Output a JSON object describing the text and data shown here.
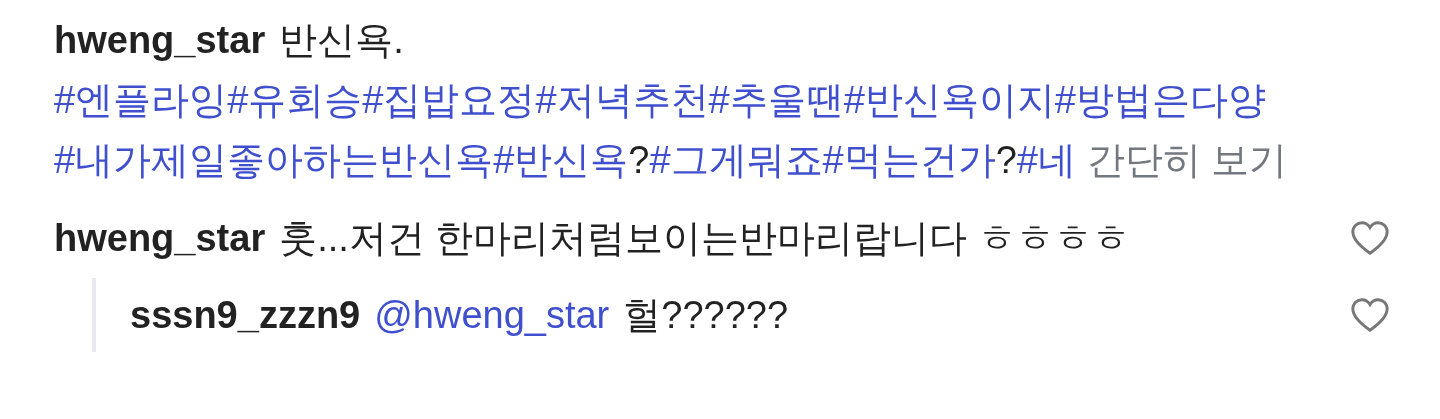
{
  "caption": {
    "username": "hweng_star",
    "text": "반신욕.",
    "parts": [
      {
        "kind": "hashtag",
        "text": "#엔플라잉"
      },
      {
        "kind": "hashtag",
        "text": "#유회승"
      },
      {
        "kind": "hashtag",
        "text": "#집밥요정"
      },
      {
        "kind": "hashtag",
        "text": "#저녁추천"
      },
      {
        "kind": "hashtag",
        "text": "#추울땐"
      },
      {
        "kind": "hashtag",
        "text": "#반신욕이지"
      },
      {
        "kind": "hashtag",
        "text": "#방법은다양"
      },
      {
        "kind": "hashtag",
        "text": "#내가제일좋아하는반신욕"
      },
      {
        "kind": "hashtag",
        "text": "#반신욕"
      },
      {
        "kind": "text",
        "text": "?"
      },
      {
        "kind": "hashtag",
        "text": "#그게뭐죠"
      },
      {
        "kind": "hashtag",
        "text": "#먹는건가"
      },
      {
        "kind": "text",
        "text": "?"
      },
      {
        "kind": "hashtag",
        "text": "#네"
      }
    ],
    "collapse_link": "간단히 보기"
  },
  "comments": [
    {
      "username": "hweng_star",
      "text": "훗...저건 한마리처럼보이는반마리랍니다 ㅎㅎㅎㅎ",
      "liked": false,
      "children": [
        {
          "username": "sssn9_zzzn9",
          "mention": "@hweng_star",
          "text": "헐??????",
          "liked": false
        }
      ]
    }
  ]
}
